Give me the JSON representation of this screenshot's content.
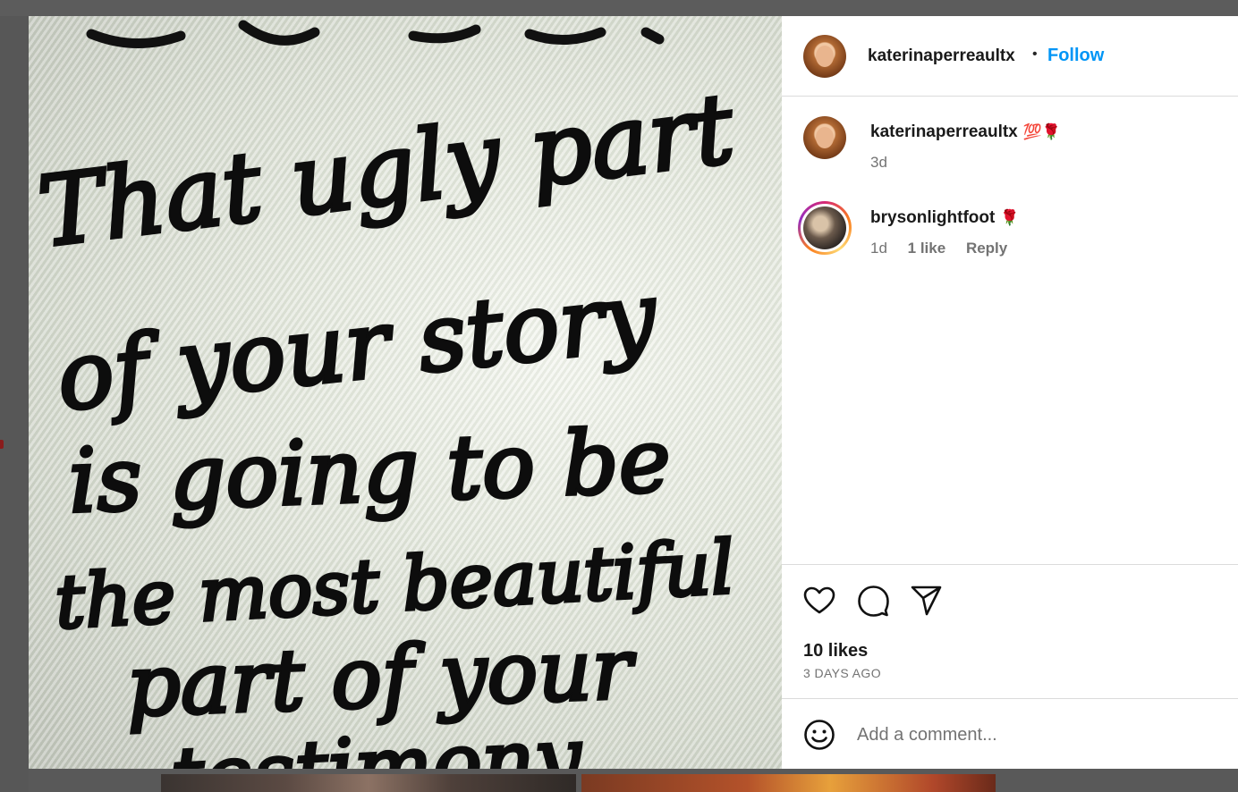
{
  "post": {
    "username": "katerinaperreaultx",
    "separator": "•",
    "follow_label": "Follow",
    "image_text_lines": [
      "That ugly part",
      "of your story",
      "is going to be",
      "the most beautiful",
      "part of your",
      "testimony."
    ]
  },
  "comments": [
    {
      "username": "katerinaperreaultx",
      "text": "💯🌹",
      "time": "3d"
    },
    {
      "username": "brysonlightfoot",
      "text": "🌹",
      "time": "1d",
      "likes": "1 like",
      "reply_label": "Reply"
    }
  ],
  "actions": {
    "likes": "10 likes",
    "date": "3 DAYS AGO"
  },
  "composer": {
    "placeholder": "Add a comment..."
  },
  "icons": {
    "like": "heart-icon",
    "comment": "comment-bubble-icon",
    "share": "paper-plane-icon",
    "emoji": "smiley-icon"
  },
  "colors": {
    "follow": "#0095f6",
    "muted_text": "#737373",
    "border": "#dbdbdb"
  }
}
